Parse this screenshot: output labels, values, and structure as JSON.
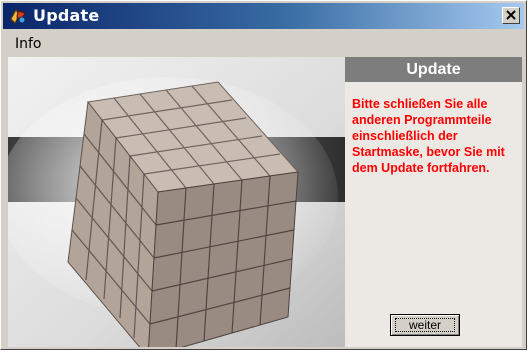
{
  "window": {
    "title": "Update",
    "app_icon": "update-app-icon",
    "close_icon": "close-icon"
  },
  "menu": {
    "items": [
      {
        "label": "Info"
      }
    ]
  },
  "panel": {
    "header": "Update",
    "message": "Bitte schließen Sie alle anderen Programmteile einschließlich der Startmaske, bevor Sie mit dem Update fortfahren.",
    "message_color": "#ff0000",
    "continue_label": "weiter"
  },
  "colors": {
    "titlebar_start": "#0a246a",
    "titlebar_end": "#a6caf0",
    "header_bg": "#7d7d7d"
  }
}
